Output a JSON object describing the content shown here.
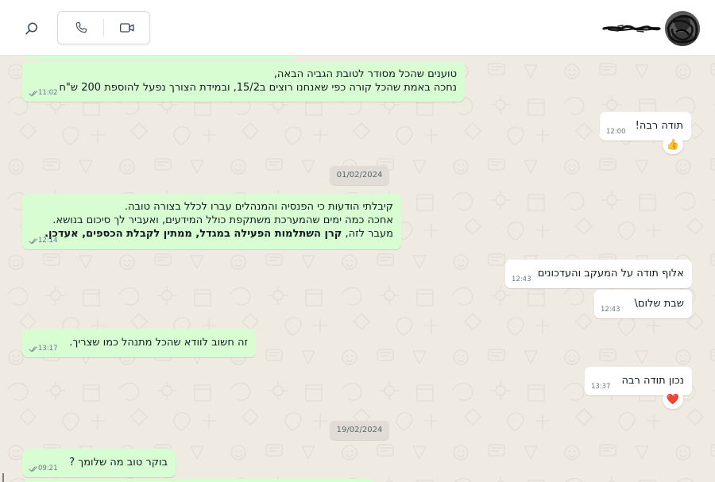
{
  "header": {
    "search_icon": "search-icon",
    "voice_call_icon": "phone-icon",
    "video_call_icon": "video-icon",
    "contact_name_redacted": true
  },
  "messages": [
    {
      "direction": "out",
      "lines": [
        "טוענים שהכל מסודר לטובת הגביה הבאה,",
        "נחכה באמת שהכל קורה כפי שאנחנו רוצים ב15/2, ובמידת הצורך נפעל להוספת 200 ש\"ח"
      ],
      "time": "11:02"
    },
    {
      "direction": "in",
      "lines": [
        "תודה רבה!"
      ],
      "time": "12:00",
      "reaction": "👍"
    },
    {
      "direction": "out",
      "lines": [
        "קיבלתי הודעות כי הפנסיה והמנהלים עברו לכלל בצורה טובה.",
        "אחכה כמה ימים שהמערכת משתקפת כולל המידעים, ואעביר לך סיכום בנושא."
      ],
      "line3_prefix": "מעבר לזה, ",
      "line3_bold": "קרן השתלמות הפעילה במגדל, ממתין לקבלת הכספים, אעדכן.",
      "time": "12:14"
    },
    {
      "direction": "in",
      "lines": [
        "אלוף תודה על המעקב והעדכונים"
      ],
      "time": "12:43"
    },
    {
      "direction": "in",
      "lines": [
        "שבת שלום\\"
      ],
      "time": "12:43"
    },
    {
      "direction": "out",
      "lines": [
        "זה חשוב לוודא שהכל מתנהל כמו שצריך."
      ],
      "time": "13:17"
    },
    {
      "direction": "in",
      "lines": [
        "נכון תודה רבה"
      ],
      "time": "13:37",
      "reaction": "❤️"
    },
    {
      "direction": "out",
      "lines": [
        "בוקר טוב מה שלומך ?"
      ],
      "time": "09:21"
    }
  ],
  "dates": [
    "01/02/2024",
    "19/02/2024"
  ],
  "colors": {
    "outgoing_bubble": "#d9fdd3",
    "incoming_bubble": "#ffffff",
    "chat_background": "#efeae2",
    "date_chip": "#e1ddd6"
  }
}
